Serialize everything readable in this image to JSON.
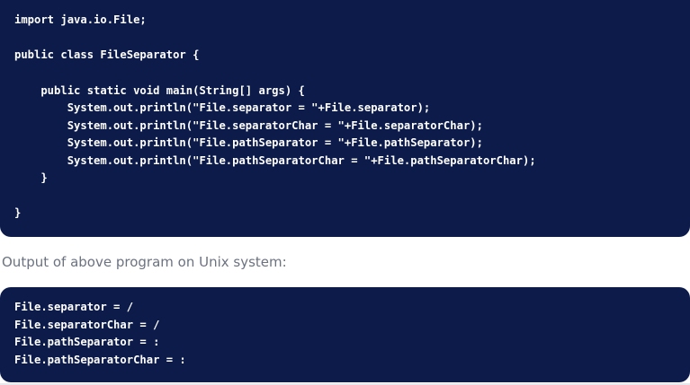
{
  "code_example": {
    "lines": [
      "import java.io.File;",
      "",
      "public class FileSeparator {",
      "",
      "    public static void main(String[] args) {",
      "        System.out.println(\"File.separator = \"+File.separator);",
      "        System.out.println(\"File.separatorChar = \"+File.separatorChar);",
      "        System.out.println(\"File.pathSeparator = \"+File.pathSeparator);",
      "        System.out.println(\"File.pathSeparatorChar = \"+File.pathSeparatorChar);",
      "    }",
      "",
      "}"
    ]
  },
  "output_caption": "Output of above program on Unix system:",
  "output_example": {
    "lines": [
      "File.separator = /",
      "File.separatorChar = /",
      "File.pathSeparator = :",
      "File.pathSeparatorChar = :"
    ]
  },
  "colors": {
    "code_background": "#0c1b4a",
    "code_text": "#ffffff",
    "caption_text": "#6b7280"
  }
}
